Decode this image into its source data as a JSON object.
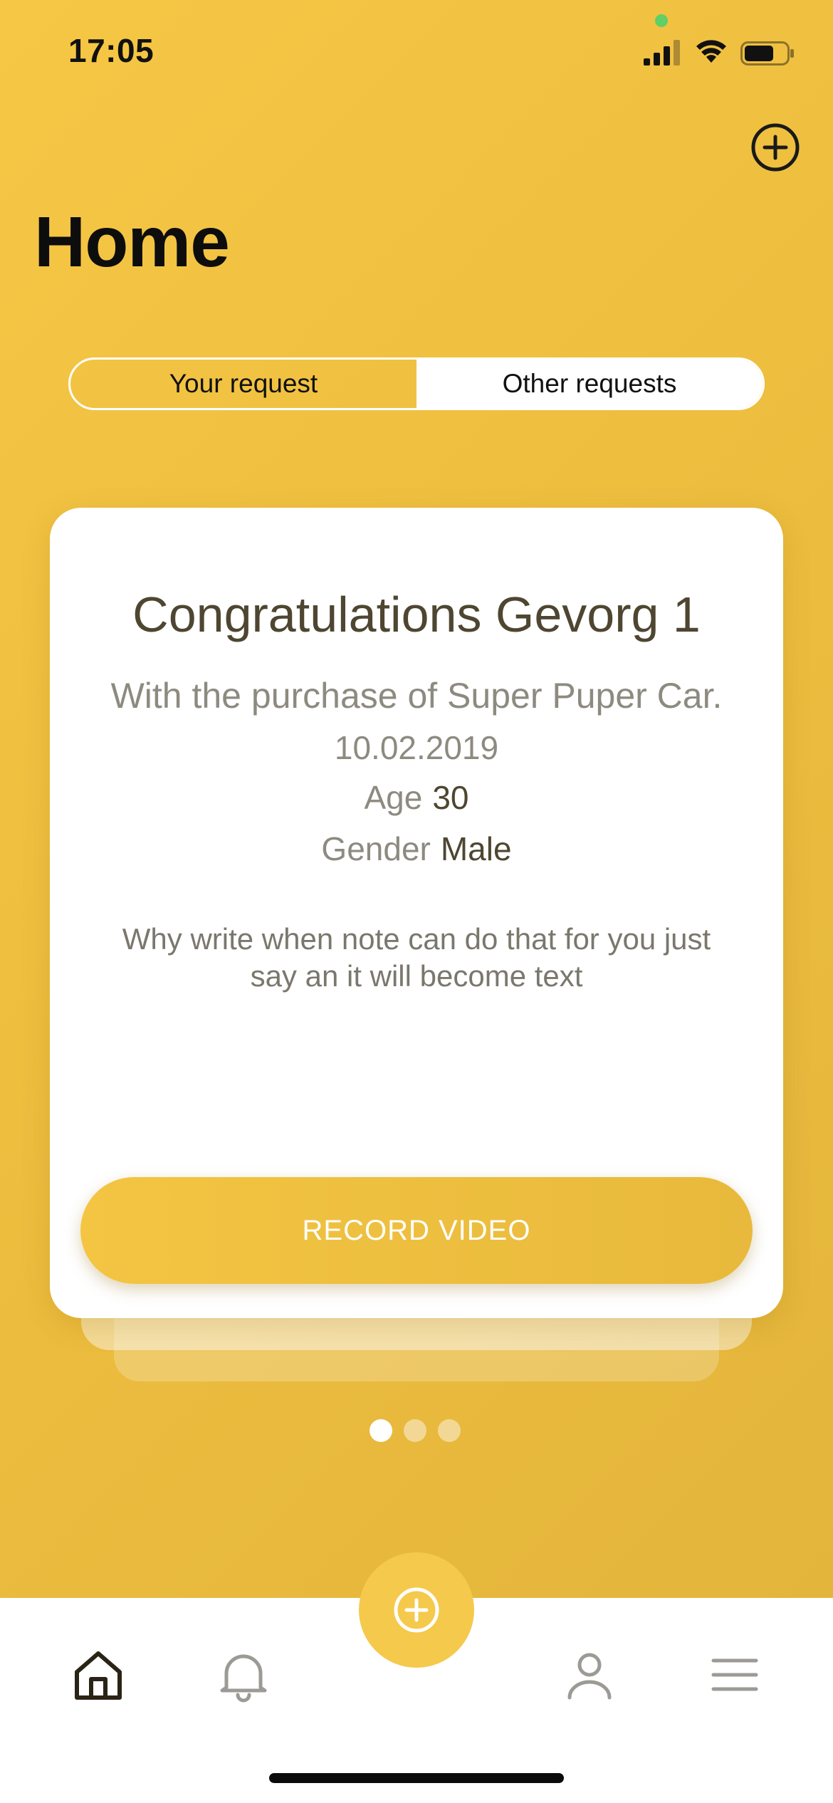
{
  "status_bar": {
    "time": "17:05"
  },
  "header": {
    "title": "Home",
    "add_icon": "plus-circle-icon"
  },
  "tabs": {
    "items": [
      {
        "label": "Your request",
        "selected": true
      },
      {
        "label": "Other requests",
        "selected": false
      }
    ]
  },
  "card": {
    "title": "Congratulations Gevorg 1",
    "subtitle": "With the purchase of Super Puper Car.",
    "date": "10.02.2019",
    "age_label": "Age",
    "age_value": "30",
    "gender_label": "Gender",
    "gender_value": "Male",
    "note": "Why write when note can do that for you just say an it will become text",
    "button_label": "RECORD VIDEO"
  },
  "pager": {
    "count": 3,
    "active_index": 0
  },
  "tab_bar": {
    "items": [
      {
        "icon": "home-icon",
        "active": true
      },
      {
        "icon": "bell-icon",
        "active": false
      },
      {
        "icon": "plus-circle-icon",
        "active": false
      },
      {
        "icon": "profile-icon",
        "active": false
      },
      {
        "icon": "menu-icon",
        "active": false
      }
    ]
  },
  "colors": {
    "accent": "#f5c94b",
    "text_dark": "#4e4631",
    "text_muted": "#8d8a80"
  }
}
